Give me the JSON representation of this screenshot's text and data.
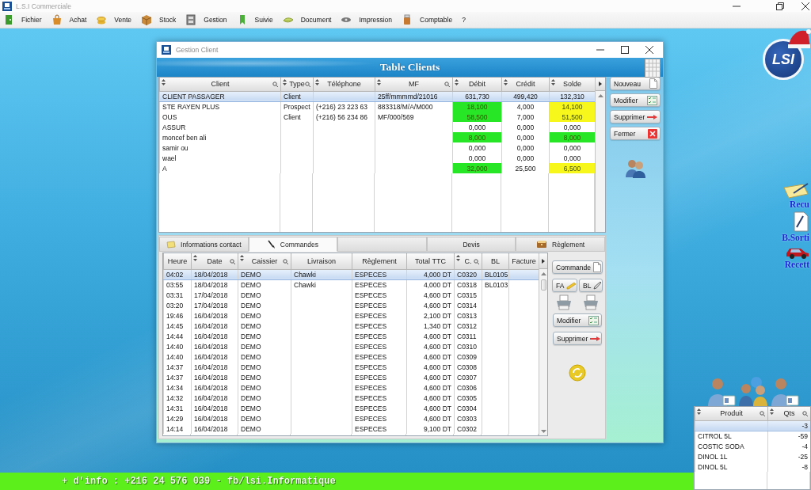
{
  "app": {
    "title": "L.S.I Commerciale"
  },
  "menu": [
    {
      "label": "Fichier"
    },
    {
      "label": "Achat"
    },
    {
      "label": "Vente"
    },
    {
      "label": "Stock"
    },
    {
      "label": "Gestion"
    },
    {
      "label": "Suivie"
    },
    {
      "label": "Document"
    },
    {
      "label": "Impression"
    },
    {
      "label": "Comptable"
    },
    {
      "label": "?"
    }
  ],
  "client_window": {
    "title": "Gestion Client",
    "banner": "Table Clients",
    "clients_table": {
      "columns": [
        {
          "label": "Client",
          "sortable": true,
          "filter": true
        },
        {
          "label": "Type",
          "sortable": true,
          "filter": true
        },
        {
          "label": "Téléphone",
          "sortable": true,
          "filter": false
        },
        {
          "label": "MF",
          "sortable": true,
          "filter": true
        },
        {
          "label": "Débit",
          "sortable": true,
          "filter": false
        },
        {
          "label": "Crédit",
          "sortable": true,
          "filter": false
        },
        {
          "label": "Solde",
          "sortable": true,
          "filter": false
        }
      ],
      "rows": [
        {
          "client": "CLIENT PASSAGER",
          "type": "Client",
          "mf": "25ff/mmmmd/21016",
          "debit": {
            "value": "631,730"
          },
          "credit": "499,420",
          "solde": {
            "value": "132,310"
          },
          "selected": true
        },
        {
          "client": "STE RAYEN PLUS",
          "type": "Prospect",
          "telephone": "(+216) 23 223 63",
          "mf": "883318/M/A/M000",
          "debit": {
            "value": "18,100",
            "color": "#26e626"
          },
          "credit": "4,000",
          "solde": {
            "value": "14,100",
            "color": "#f7f71c"
          },
          "selected": false
        },
        {
          "client": "OUS",
          "type": "Client",
          "telephone": "(+216) 56 234 86",
          "mf": "MF/000/569",
          "debit": {
            "value": "58,500",
            "color": "#26e626"
          },
          "credit": "7,000",
          "solde": {
            "value": "51,500",
            "color": "#f7f71c"
          },
          "selected": false
        },
        {
          "client": "ASSUR",
          "debit": {
            "value": "0,000"
          },
          "credit": "0,000",
          "solde": {
            "value": "0,000"
          },
          "selected": false
        },
        {
          "client": "moncef ben ali",
          "debit": {
            "value": "8,000",
            "color": "#26e626"
          },
          "credit": "0,000",
          "solde": {
            "value": "8,000",
            "color": "#26e626"
          },
          "selected": false
        },
        {
          "client": "samir ou",
          "debit": {
            "value": "0,000"
          },
          "credit": "0,000",
          "solde": {
            "value": "0,000"
          },
          "selected": false
        },
        {
          "client": "wael",
          "debit": {
            "value": "0,000"
          },
          "credit": "0,000",
          "solde": {
            "value": "0,000"
          },
          "selected": false
        },
        {
          "client": "A",
          "debit": {
            "value": "32,000",
            "color": "#26e626"
          },
          "credit": "25,500",
          "solde": {
            "value": "6,500",
            "color": "#f7f71c"
          },
          "selected": false
        }
      ]
    },
    "client_buttons": [
      {
        "label": "Nouveau"
      },
      {
        "label": "Modifier"
      },
      {
        "label": "Supprimer"
      },
      {
        "label": "Fermer"
      }
    ],
    "tabs": [
      {
        "label": "Informations contact",
        "selected": false
      },
      {
        "label": "Commandes",
        "selected": true
      },
      {
        "selected": false
      },
      {
        "label": "Devis",
        "selected": false
      },
      {
        "label": "Règlement",
        "selected": false
      }
    ],
    "orders_table": {
      "columns": [
        {
          "label": "Heure",
          "sortable": false,
          "filter": false
        },
        {
          "label": "Date",
          "sortable": true,
          "filter": true
        },
        {
          "label": "Caissier",
          "sortable": true,
          "filter": true
        },
        {
          "label": "Livraison",
          "sortable": false,
          "filter": false
        },
        {
          "label": "Règlement",
          "sortable": false,
          "filter": false
        },
        {
          "label": "Total TTC",
          "sortable": false,
          "filter": false
        },
        {
          "label": "C.",
          "sortable": true,
          "filter": true
        },
        {
          "label": "BL",
          "sortable": false,
          "filter": false
        },
        {
          "label": "Facture",
          "sortable": false,
          "filter": false
        }
      ],
      "rows": [
        {
          "heure": "04:02",
          "date": "18/04/2018",
          "caissier": "DEMO",
          "livraison": "Chawki",
          "reglement": "ESPECES",
          "total_ttc": "4,000 DT",
          "c": "C0320",
          "bl": "BL0105",
          "selected": true
        },
        {
          "heure": "03:55",
          "date": "18/04/2018",
          "caissier": "DEMO",
          "livraison": "Chawki",
          "reglement": "ESPECES",
          "total_ttc": "4,000 DT",
          "c": "C0318",
          "bl": "BL0103",
          "selected": false
        },
        {
          "heure": "03:31",
          "date": "17/04/2018",
          "caissier": "DEMO",
          "reglement": "ESPECES",
          "total_ttc": "4,600 DT",
          "c": "C0315",
          "selected": false
        },
        {
          "heure": "03:20",
          "date": "17/04/2018",
          "caissier": "DEMO",
          "reglement": "ESPECES",
          "total_ttc": "4,600 DT",
          "c": "C0314",
          "selected": false
        },
        {
          "heure": "19:46",
          "date": "16/04/2018",
          "caissier": "DEMO",
          "reglement": "ESPECES",
          "total_ttc": "2,100 DT",
          "c": "C0313",
          "selected": false
        },
        {
          "heure": "14:45",
          "date": "16/04/2018",
          "caissier": "DEMO",
          "reglement": "ESPECES",
          "total_ttc": "1,340 DT",
          "c": "C0312",
          "selected": false
        },
        {
          "heure": "14:44",
          "date": "16/04/2018",
          "caissier": "DEMO",
          "reglement": "ESPECES",
          "total_ttc": "4,600 DT",
          "c": "C0311",
          "selected": false
        },
        {
          "heure": "14:40",
          "date": "16/04/2018",
          "caissier": "DEMO",
          "reglement": "ESPECES",
          "total_ttc": "4,600 DT",
          "c": "C0310",
          "selected": false
        },
        {
          "heure": "14:40",
          "date": "16/04/2018",
          "caissier": "DEMO",
          "reglement": "ESPECES",
          "total_ttc": "4,600 DT",
          "c": "C0309",
          "selected": false
        },
        {
          "heure": "14:37",
          "date": "16/04/2018",
          "caissier": "DEMO",
          "reglement": "ESPECES",
          "total_ttc": "4,600 DT",
          "c": "C0308",
          "selected": false
        },
        {
          "heure": "14:37",
          "date": "16/04/2018",
          "caissier": "DEMO",
          "reglement": "ESPECES",
          "total_ttc": "4,600 DT",
          "c": "C0307",
          "selected": false
        },
        {
          "heure": "14:34",
          "date": "16/04/2018",
          "caissier": "DEMO",
          "reglement": "ESPECES",
          "total_ttc": "4,600 DT",
          "c": "C0306",
          "selected": false
        },
        {
          "heure": "14:32",
          "date": "16/04/2018",
          "caissier": "DEMO",
          "reglement": "ESPECES",
          "total_ttc": "4,600 DT",
          "c": "C0305",
          "selected": false
        },
        {
          "heure": "14:31",
          "date": "16/04/2018",
          "caissier": "DEMO",
          "reglement": "ESPECES",
          "total_ttc": "4,600 DT",
          "c": "C0304",
          "selected": false
        },
        {
          "heure": "14:29",
          "date": "16/04/2018",
          "caissier": "DEMO",
          "reglement": "ESPECES",
          "total_ttc": "4,600 DT",
          "c": "C0303",
          "selected": false
        },
        {
          "heure": "14:14",
          "date": "16/04/2018",
          "caissier": "DEMO",
          "reglement": "ESPECES",
          "total_ttc": "9,100 DT",
          "c": "C0302",
          "selected": false
        }
      ]
    },
    "order_buttons": [
      {
        "label": "Commande",
        "kind": "wide"
      },
      {
        "label": "FA",
        "kind": "half"
      },
      {
        "label": "BL",
        "kind": "half"
      },
      {
        "label": "Modifier",
        "kind": "wide"
      },
      {
        "label": "Supprimer",
        "kind": "wide"
      }
    ]
  },
  "logo": "LSI",
  "shortcuts": [
    {
      "label": "Recu"
    },
    {
      "label": "B.Sorti"
    },
    {
      "label": "Recett"
    }
  ],
  "stock_table": {
    "columns": [
      {
        "label": "Produit",
        "sortable": true,
        "filter": true
      },
      {
        "label": "Qts",
        "sortable": true,
        "filter": true
      }
    ],
    "rows": [
      {
        "qts": "-3",
        "selected": true
      },
      {
        "produit": "CITROL 5L",
        "qts": "-59",
        "selected": false
      },
      {
        "produit": "COSTIC SODA",
        "qts": "-4",
        "selected": false
      },
      {
        "produit": "DINOL 1L",
        "qts": "-25",
        "selected": false
      },
      {
        "produit": "DINOL 5L",
        "qts": "-8",
        "selected": false
      }
    ]
  },
  "info_bar": "+ d'info : +216 24 576 039 - fb/lsi.Informatique"
}
